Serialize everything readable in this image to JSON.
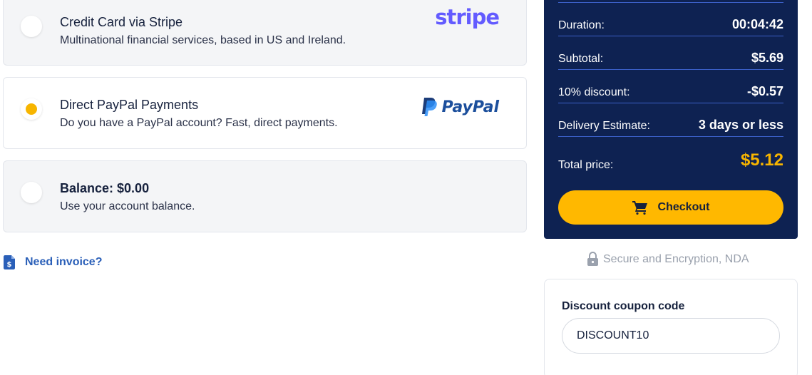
{
  "payment_options": [
    {
      "title": "Credit Card via Stripe",
      "description": "Multinational financial services, based in US and Ireland.",
      "logo": "stripe",
      "selected": false
    },
    {
      "title": "Direct PayPal Payments",
      "description": "Do you have a PayPal account? Fast, direct payments.",
      "logo": "PayPal",
      "selected": true
    },
    {
      "title": "Balance: $0.00",
      "description": "Use your account balance.",
      "selected": false
    }
  ],
  "invoice": {
    "label": "Need invoice?",
    "icon": "invoice-dollar-icon"
  },
  "summary": {
    "rows": [
      {
        "label": "Duration:",
        "value": "00:04:42"
      },
      {
        "label": "Subtotal:",
        "value": "$5.69"
      },
      {
        "label": "10% discount:",
        "value": "-$0.57"
      },
      {
        "label": "Delivery Estimate:",
        "value": "3 days or less"
      }
    ],
    "total_label": "Total price:",
    "total_value": "$5.12",
    "checkout_label": "Checkout",
    "checkout_icon": "cart-icon"
  },
  "secure": {
    "text": "Secure and Encryption, NDA",
    "icon": "lock-icon"
  },
  "coupon": {
    "label": "Discount coupon code",
    "value": "DISCOUNT10"
  },
  "colors": {
    "summary_bg": "#0e2252",
    "accent": "#ffb800",
    "stripe": "#635bff",
    "paypal": "#1c4f9c",
    "link": "#2a5fb8"
  }
}
